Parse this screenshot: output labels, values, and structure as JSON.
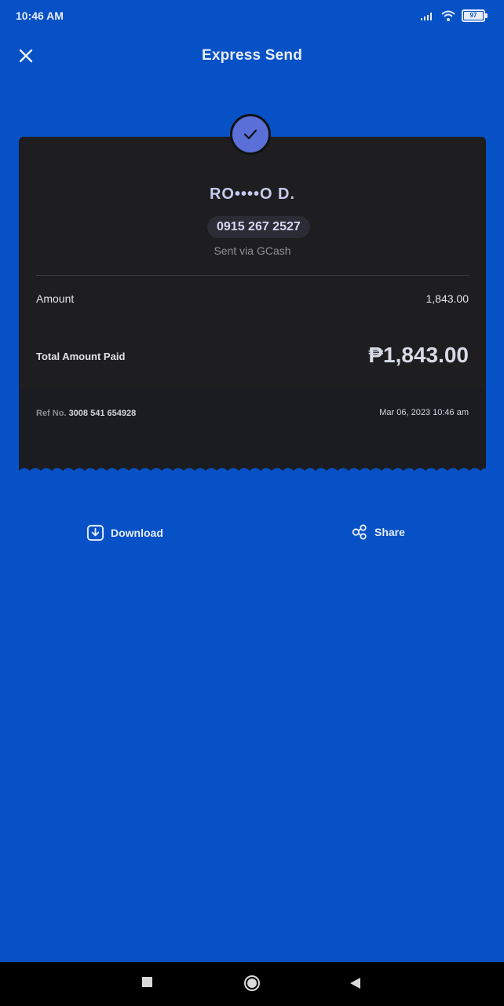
{
  "status_bar": {
    "time": "10:46 AM",
    "battery": "97"
  },
  "header": {
    "title": "Express Send",
    "close_icon": "close-icon"
  },
  "receipt": {
    "recipient_name": "RO••••O D.",
    "phone": "0915 267 2527",
    "sent_via": "Sent via GCash",
    "amount_label": "Amount",
    "amount_value": "1,843.00",
    "total_label": "Total Amount Paid",
    "total_value": "₱1,843.00",
    "ref_label": "Ref No.",
    "ref_number": "3008 541 654928",
    "date": "Mar 06, 2023 10:46 am"
  },
  "actions": {
    "download_label": "Download",
    "share_label": "Share"
  },
  "colors": {
    "background": "#0651c6",
    "card": "#1e1e20",
    "accent": "#5a6fd8"
  }
}
